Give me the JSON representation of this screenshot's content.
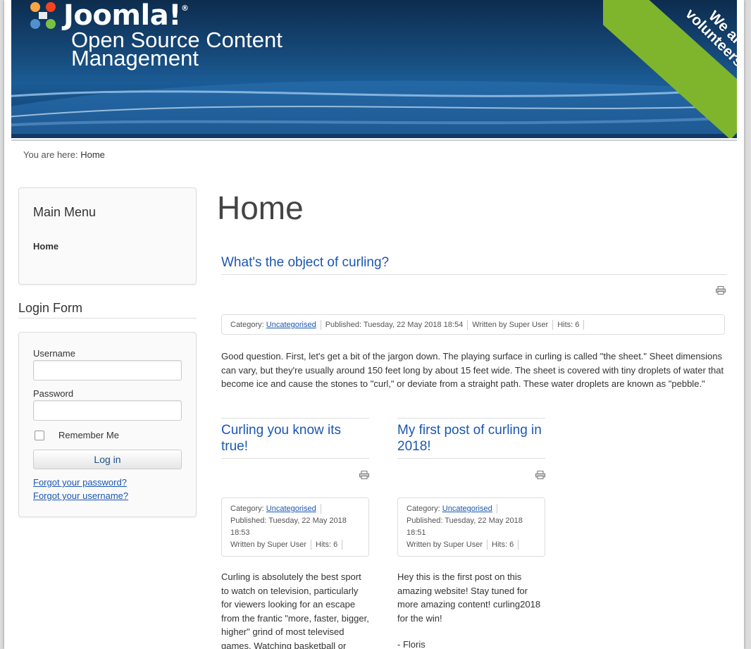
{
  "header": {
    "logo_text": "Joomla!",
    "site_title": "Open Source Content Management",
    "ribbon_text": "We are volunteers !"
  },
  "breadcrumb": {
    "prefix": "You are here:",
    "current": "Home"
  },
  "main_menu": {
    "title": "Main Menu",
    "items": [
      {
        "label": "Home"
      }
    ]
  },
  "login_form": {
    "title": "Login Form",
    "username_label": "Username",
    "password_label": "Password",
    "remember_label": "Remember Me",
    "login_button": "Log in",
    "forgot_password": "Forgot your password?",
    "forgot_username": "Forgot your username?"
  },
  "page_heading": "Home",
  "articles": [
    {
      "title": "What's the object of curling?",
      "category_label": "Category:",
      "category": "Uncategorised",
      "published": "Published: Tuesday, 22 May 2018 18:54",
      "author": "Written by Super User",
      "hits": "Hits: 6",
      "text": "Good question. First, let's get a bit of the jargon down. The playing surface in curling is called \"the sheet.\" Sheet dimensions can vary, but they're usually around 150 feet long by about 15 feet wide. The sheet is covered with tiny droplets of water that become ice and cause the stones to \"curl,\" or deviate from a straight path. These water droplets are known as \"pebble.\""
    },
    {
      "title": "Curling you know its true!",
      "category_label": "Category:",
      "category": "Uncategorised",
      "published_line1": "Published: Tuesday, 22 May 2018",
      "published_line2": "18:53",
      "author": "Written by Super User",
      "hits": "Hits: 6",
      "text": "Curling is absolutely the best sport to watch on television, particularly for viewers looking for an escape from the frantic \"more, faster, bigger, higher\" grind of most televised games. Watching basketball or"
    },
    {
      "title": "My first post of curling in 2018!",
      "category_label": "Category:",
      "category": "Uncategorised",
      "published_line1": "Published: Tuesday, 22 May 2018",
      "published_line2": "18:51",
      "author": "Written by Super User",
      "hits": "Hits: 6",
      "text": "Hey this is the first post on this amazing website! Stay tuned for more amazing content! curling2018 for the win!",
      "signature": "- Floris"
    }
  ],
  "icons": {
    "print": "print-icon",
    "logo": "joomla-logo-icon"
  }
}
